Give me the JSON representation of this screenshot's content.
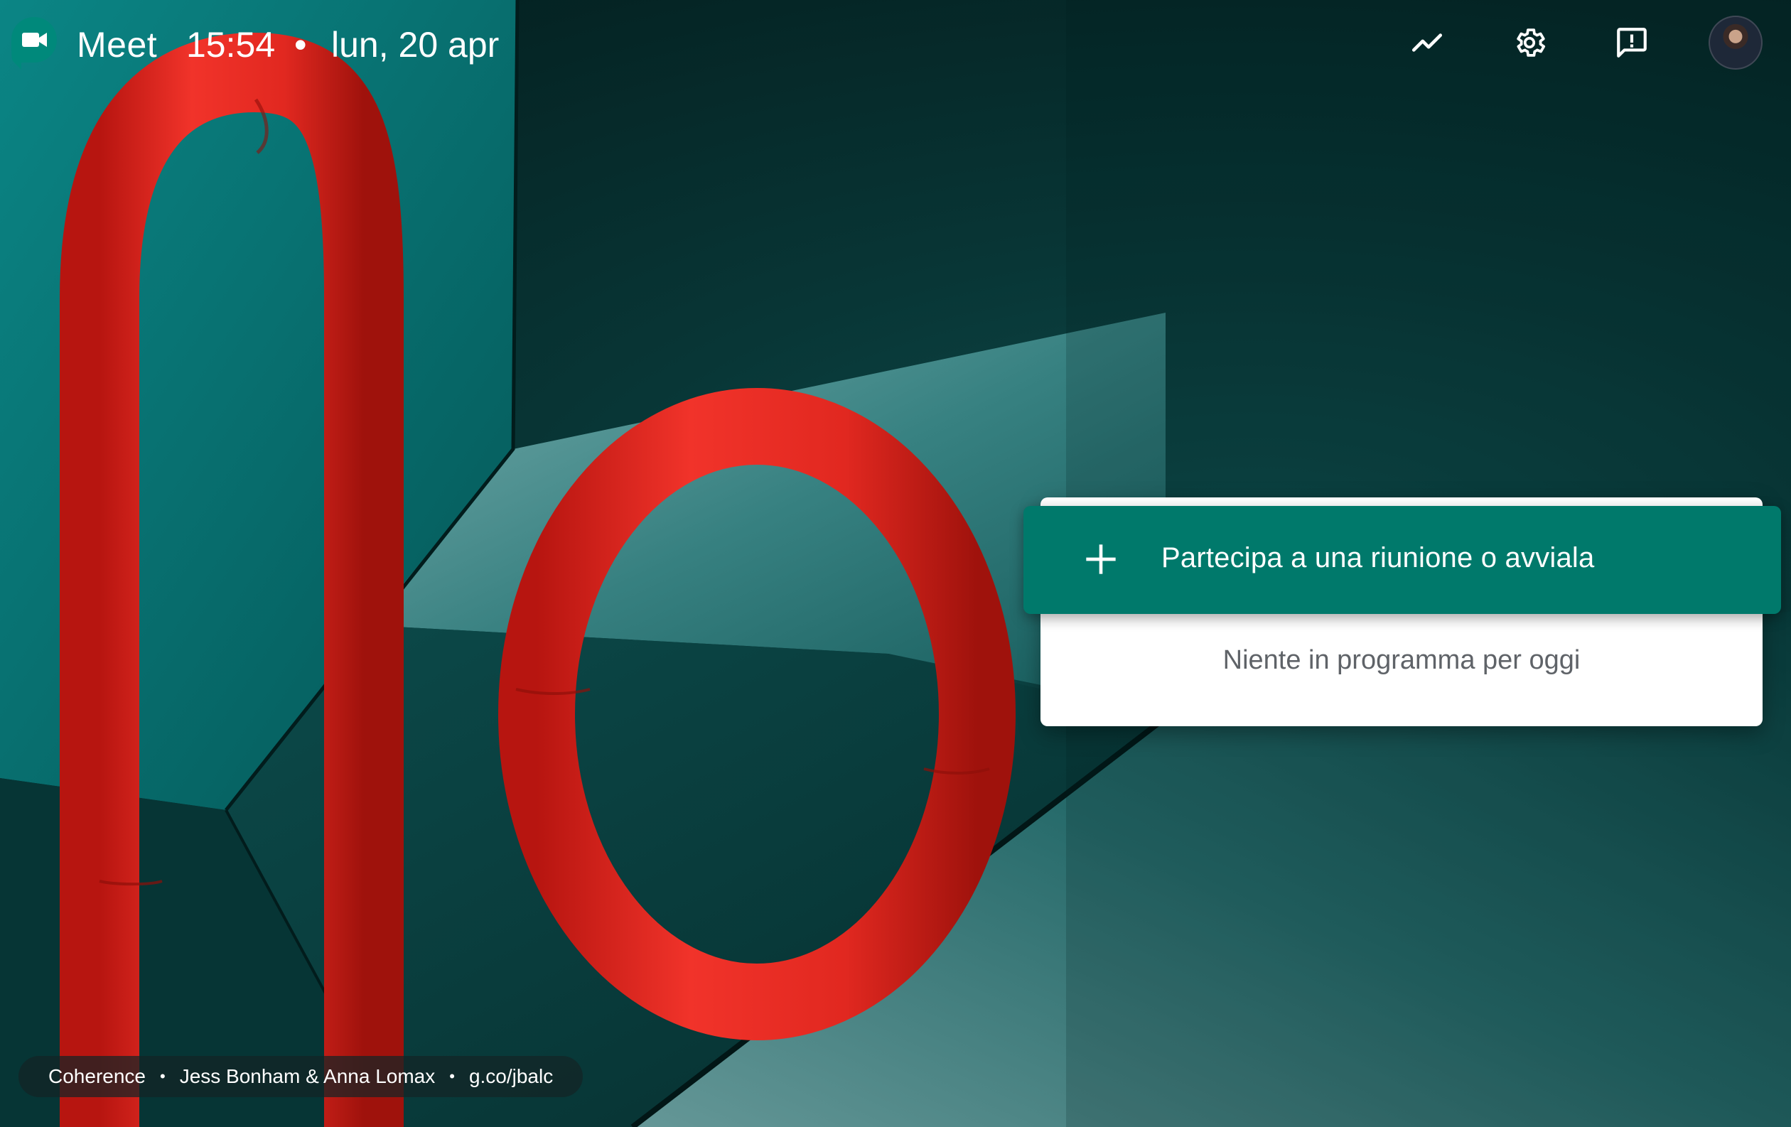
{
  "header": {
    "app_name": "Meet",
    "time": "15:54",
    "separator": "•",
    "date": "lun, 20 apr",
    "icons": {
      "logo": "google-meet-logo",
      "stats": "trending-chart-icon",
      "settings": "gear-icon",
      "feedback": "feedback-icon",
      "avatar": "account-avatar"
    }
  },
  "card": {
    "join_label": "Partecipa a una riunione o avviala",
    "join_icon": "plus-icon",
    "empty_message": "Niente in programma per oggi"
  },
  "credit": {
    "title": "Coherence",
    "artists": "Jess Bonham & Anna Lomax",
    "link": "g.co/jbalc",
    "separator": "•"
  },
  "colors": {
    "accent": "#00796b",
    "background": "#083636",
    "tube_red": "#e3281f",
    "logo_green": "#00897b"
  }
}
